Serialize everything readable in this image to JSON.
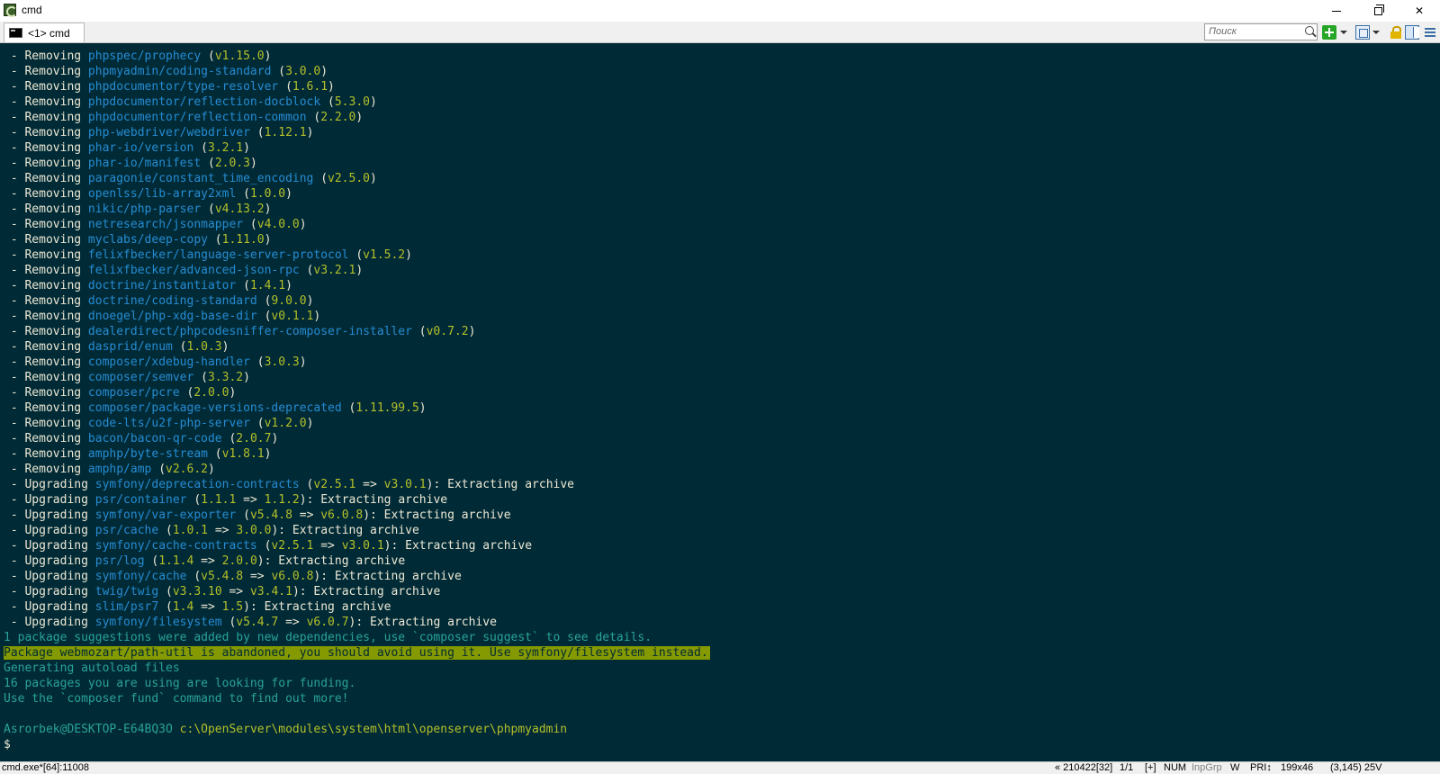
{
  "window": {
    "title": "cmd",
    "tab_label": "<1> cmd",
    "search_placeholder": "Поиск"
  },
  "console": {
    "removing_prefix": " - Removing ",
    "upgrading_prefix": " - Upgrading ",
    "removing": [
      {
        "pkg": "phpspec/prophecy",
        "ver": "v1.15.0"
      },
      {
        "pkg": "phpmyadmin/coding-standard",
        "ver": "3.0.0"
      },
      {
        "pkg": "phpdocumentor/type-resolver",
        "ver": "1.6.1"
      },
      {
        "pkg": "phpdocumentor/reflection-docblock",
        "ver": "5.3.0"
      },
      {
        "pkg": "phpdocumentor/reflection-common",
        "ver": "2.2.0"
      },
      {
        "pkg": "php-webdriver/webdriver",
        "ver": "1.12.1"
      },
      {
        "pkg": "phar-io/version",
        "ver": "3.2.1"
      },
      {
        "pkg": "phar-io/manifest",
        "ver": "2.0.3"
      },
      {
        "pkg": "paragonie/constant_time_encoding",
        "ver": "v2.5.0"
      },
      {
        "pkg": "openlss/lib-array2xml",
        "ver": "1.0.0"
      },
      {
        "pkg": "nikic/php-parser",
        "ver": "v4.13.2"
      },
      {
        "pkg": "netresearch/jsonmapper",
        "ver": "v4.0.0"
      },
      {
        "pkg": "myclabs/deep-copy",
        "ver": "1.11.0"
      },
      {
        "pkg": "felixfbecker/language-server-protocol",
        "ver": "v1.5.2"
      },
      {
        "pkg": "felixfbecker/advanced-json-rpc",
        "ver": "v3.2.1"
      },
      {
        "pkg": "doctrine/instantiator",
        "ver": "1.4.1"
      },
      {
        "pkg": "doctrine/coding-standard",
        "ver": "9.0.0"
      },
      {
        "pkg": "dnoegel/php-xdg-base-dir",
        "ver": "v0.1.1"
      },
      {
        "pkg": "dealerdirect/phpcodesniffer-composer-installer",
        "ver": "v0.7.2"
      },
      {
        "pkg": "dasprid/enum",
        "ver": "1.0.3"
      },
      {
        "pkg": "composer/xdebug-handler",
        "ver": "3.0.3"
      },
      {
        "pkg": "composer/semver",
        "ver": "3.3.2"
      },
      {
        "pkg": "composer/pcre",
        "ver": "2.0.0"
      },
      {
        "pkg": "composer/package-versions-deprecated",
        "ver": "1.11.99.5"
      },
      {
        "pkg": "code-lts/u2f-php-server",
        "ver": "v1.2.0"
      },
      {
        "pkg": "bacon/bacon-qr-code",
        "ver": "2.0.7"
      },
      {
        "pkg": "amphp/byte-stream",
        "ver": "v1.8.1"
      },
      {
        "pkg": "amphp/amp",
        "ver": "v2.6.2"
      }
    ],
    "upgrading": [
      {
        "pkg": "symfony/deprecation-contracts",
        "from": "v2.5.1",
        "to": "v3.0.1"
      },
      {
        "pkg": "psr/container",
        "from": "1.1.1",
        "to": "1.1.2"
      },
      {
        "pkg": "symfony/var-exporter",
        "from": "v5.4.8",
        "to": "v6.0.8"
      },
      {
        "pkg": "psr/cache",
        "from": "1.0.1",
        "to": "3.0.0"
      },
      {
        "pkg": "symfony/cache-contracts",
        "from": "v2.5.1",
        "to": "v3.0.1"
      },
      {
        "pkg": "psr/log",
        "from": "1.1.4",
        "to": "2.0.0"
      },
      {
        "pkg": "symfony/cache",
        "from": "v5.4.8",
        "to": "v6.0.8"
      },
      {
        "pkg": "twig/twig",
        "from": "v3.3.10",
        "to": "v3.4.1"
      },
      {
        "pkg": "slim/psr7",
        "from": "1.4",
        "to": "1.5"
      },
      {
        "pkg": "symfony/filesystem",
        "from": "v5.4.7",
        "to": "v6.0.7"
      }
    ],
    "upgrade_suffix": "): Extracting archive",
    "info_lines": [
      "1 package suggestions were added by new dependencies, use `composer suggest` to see details."
    ],
    "warning": "Package webmozart/path-util is abandoned, you should avoid using it. Use symfony/filesystem instead.",
    "post_lines": [
      "Generating autoload files",
      "16 packages you are using are looking for funding.",
      "Use the `composer fund` command to find out more!"
    ],
    "prompt_user": "Asrorbek@DESKTOP-E64BQ3O",
    "prompt_path": "c:\\OpenServer\\modules\\system\\html\\openserver\\phpmyadmin",
    "prompt_symbol": "$"
  },
  "statusbar": {
    "left": "cmd.exe*[64]:11008",
    "position": "« 210422[32]",
    "pages": "1/1",
    "plus": "[+]",
    "num": "NUM",
    "inpgrp": "InpGrp",
    "w": "W",
    "pri": "PRI↕",
    "size": "199x46",
    "cursor": "(3,145) 25V"
  },
  "colors": {
    "console_bg": "#002b36",
    "package": "#268bd2",
    "version": "#b5bf29",
    "info": "#2aa198",
    "warning_bg": "#859900",
    "text": "#eee8d5"
  },
  "icons": [
    "app-icon",
    "minimize-icon",
    "maximize-icon",
    "close-icon",
    "console-tab-icon",
    "search-icon",
    "add-console-icon",
    "dropdown-icon",
    "panels-icon",
    "lock-icon",
    "window-icon",
    "menu-icon"
  ]
}
